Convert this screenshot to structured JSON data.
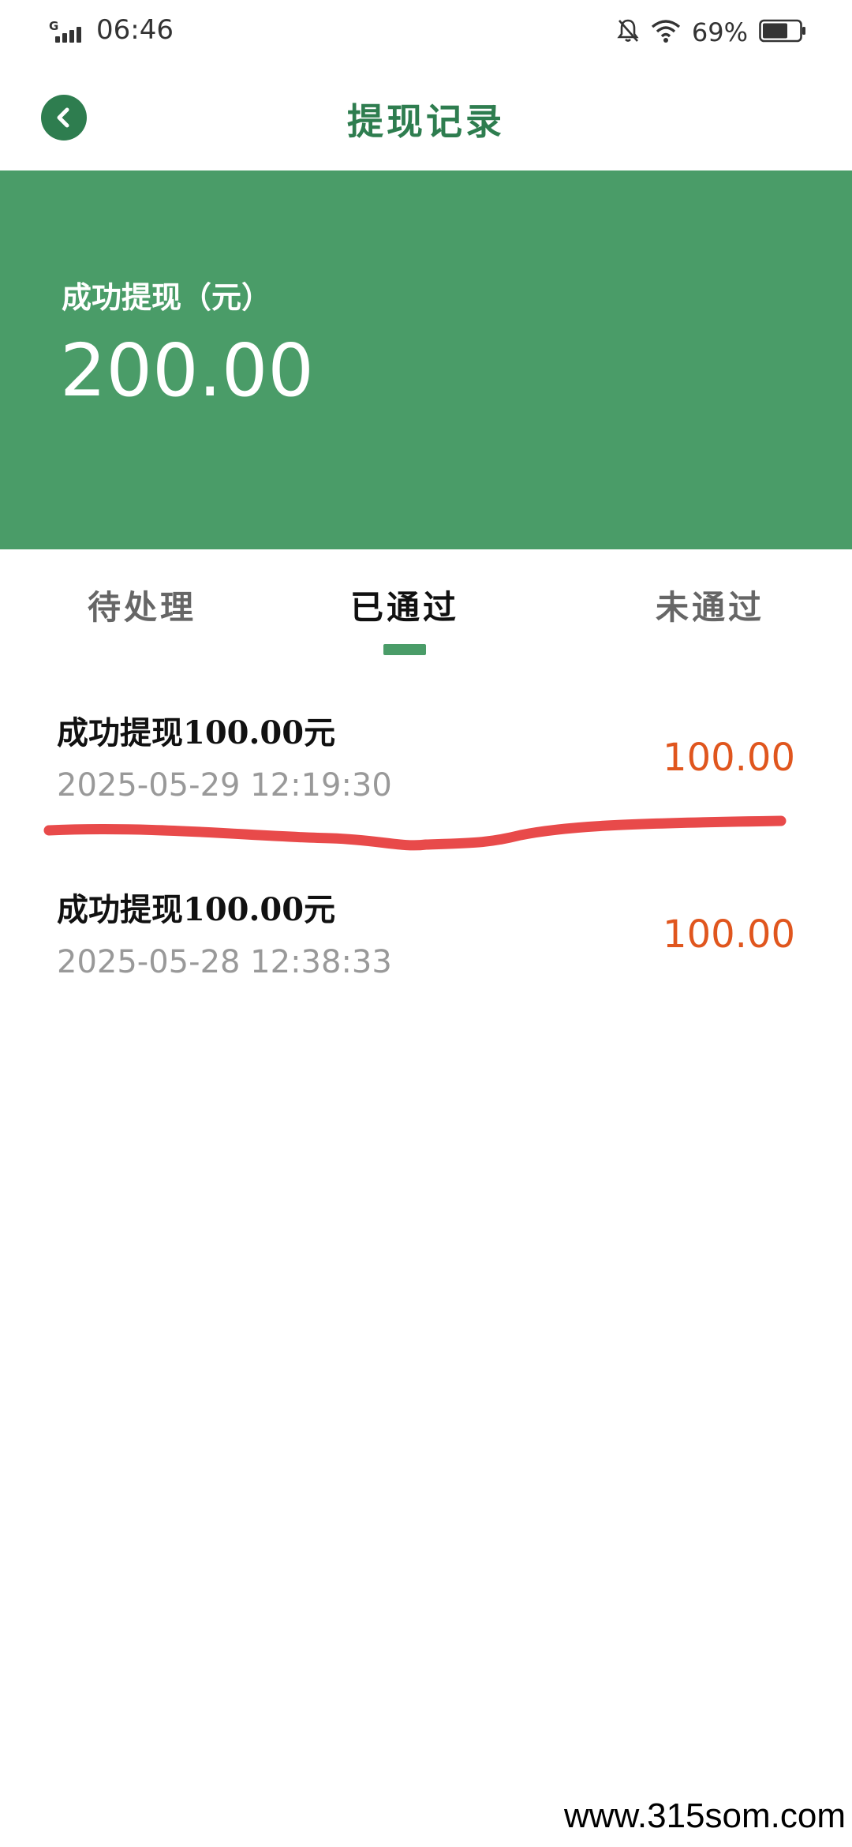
{
  "status_bar": {
    "network_label": "G",
    "time": "06:46",
    "battery_percent": "69%",
    "battery_level": 0.69,
    "icons": [
      "signal-icon",
      "bell-off-icon",
      "wifi-icon",
      "battery-icon"
    ]
  },
  "header": {
    "title": "提现记录",
    "back_icon": "chevron-left-icon"
  },
  "summary": {
    "label": "成功提现（元）",
    "amount": "200.00"
  },
  "tabs": [
    {
      "label": "待处理",
      "active": false
    },
    {
      "label": "已通过",
      "active": true
    },
    {
      "label": "未通过",
      "active": false
    }
  ],
  "records": [
    {
      "title": "成功提现100.00元",
      "time": "2025-05-29 12:19:30",
      "amount": "100.00"
    },
    {
      "title": "成功提现100.00元",
      "time": "2025-05-28 12:38:33",
      "amount": "100.00"
    }
  ],
  "watermark": "www.315som.com",
  "colors": {
    "brand_green": "#2e7d4f",
    "banner_green": "#4a9c68",
    "amount_orange": "#e0561e",
    "annotation_red": "#e84a4a"
  }
}
